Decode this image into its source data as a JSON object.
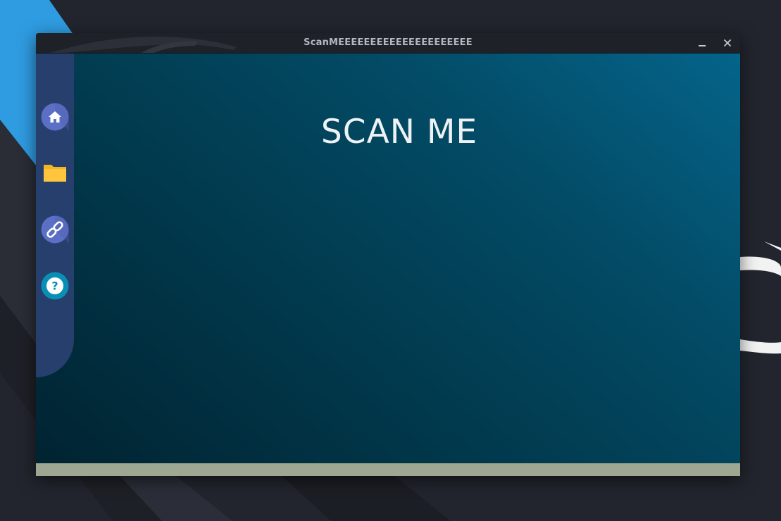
{
  "window": {
    "title": "ScanMEEEEEEEEEEEEEEEEEEEEE"
  },
  "titlebar_controls": {
    "minimize_icon": "minimize-icon",
    "close_icon": "close-icon"
  },
  "sidebar": {
    "items": [
      {
        "id": "home",
        "icon": "home-icon",
        "color": "#5b6fc4"
      },
      {
        "id": "files",
        "icon": "folder-icon",
        "color": "#ffc63d"
      },
      {
        "id": "link",
        "icon": "link-icon",
        "color": "#5b6fc4"
      },
      {
        "id": "help",
        "icon": "help-icon",
        "color": "#0a8fb4"
      }
    ],
    "background": "#263f6c"
  },
  "main": {
    "heading": "SCAN ME"
  },
  "colors": {
    "content_gradient_start": "#012331",
    "content_gradient_end": "#04648a",
    "status_bar": "#9ea792",
    "titlebar": "#1f2128"
  }
}
